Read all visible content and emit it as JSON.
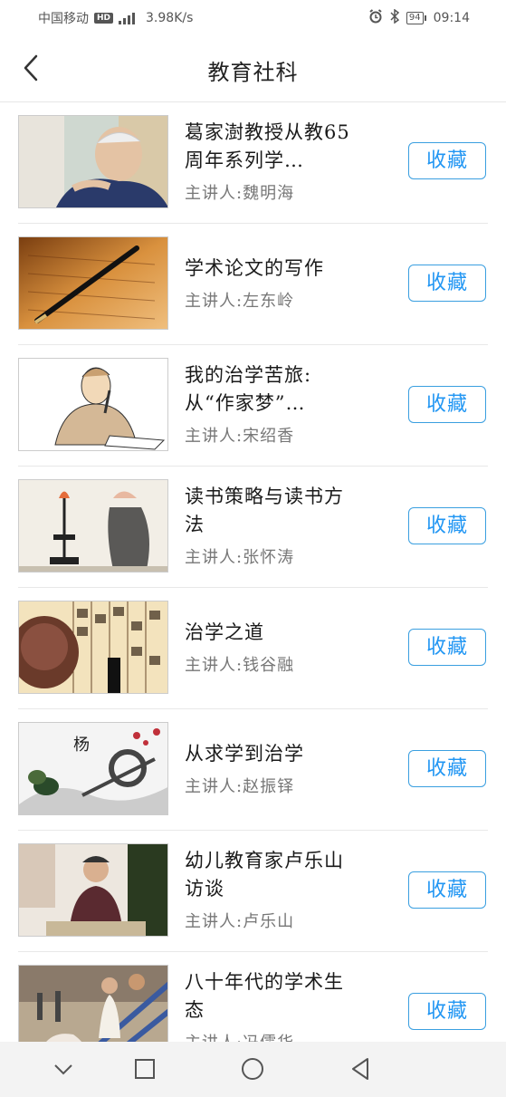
{
  "status": {
    "carrier": "中国移动",
    "hd": "HD",
    "network": "4G",
    "speed": "3.98K/s",
    "battery": "94",
    "time": "09:14"
  },
  "header": {
    "title": "教育社科"
  },
  "items": [
    {
      "title": "葛家澍教授从教65周年系列学…",
      "lecturer": "主讲人:魏明海",
      "button": "收藏"
    },
    {
      "title": "学术论文的写作",
      "lecturer": "主讲人:左东岭",
      "button": "收藏"
    },
    {
      "title": "我的治学苦旅:从“作家梦”…",
      "lecturer": "主讲人:宋绍香",
      "button": "收藏"
    },
    {
      "title": "读书策略与读书方法",
      "lecturer": "主讲人:张怀涛",
      "button": "收藏"
    },
    {
      "title": "治学之道",
      "lecturer": "主讲人:钱谷融",
      "button": "收藏"
    },
    {
      "title": "从求学到治学",
      "lecturer": "主讲人:赵振铎",
      "button": "收藏"
    },
    {
      "title": "幼儿教育家卢乐山访谈",
      "lecturer": "主讲人:卢乐山",
      "button": "收藏"
    },
    {
      "title": "八十年代的学术生态",
      "lecturer": "主讲人:冯儒华",
      "button": "收藏"
    }
  ]
}
